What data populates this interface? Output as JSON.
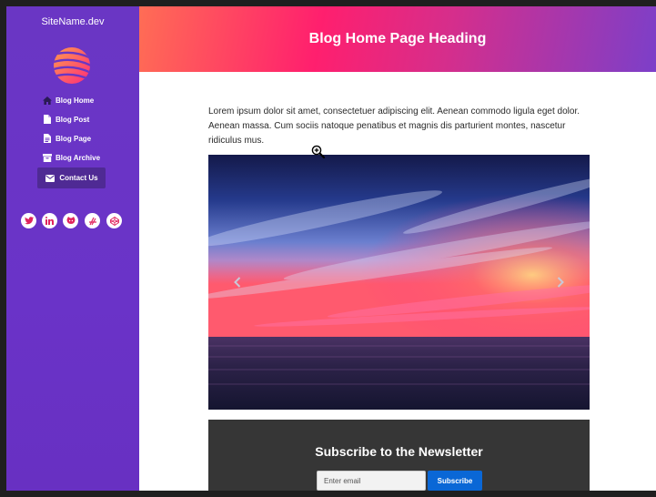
{
  "sidebar": {
    "site_name": "SiteName.dev",
    "items": [
      {
        "label": "Blog Home",
        "icon": "home-icon"
      },
      {
        "label": "Blog Post",
        "icon": "file-icon"
      },
      {
        "label": "Blog Page",
        "icon": "file-text-icon"
      },
      {
        "label": "Blog Archive",
        "icon": "archive-icon"
      },
      {
        "label": "Contact Us",
        "icon": "envelope-icon"
      }
    ],
    "social": [
      "twitter-icon",
      "linkedin-icon",
      "github-icon",
      "jsfiddle-icon",
      "codepen-icon"
    ]
  },
  "header": {
    "title": "Blog Home Page Heading"
  },
  "main": {
    "intro": "Lorem ipsum dolor sit amet, consectetuer adipiscing elit. Aenean commodo ligula eget dolor. Aenean massa. Cum sociis natoque penatibus et magnis dis parturient montes, nascetur ridiculus mus.",
    "carousel": {
      "image": "sunset over the sea",
      "prev_icon": "chevron-left-icon",
      "next_icon": "chevron-right-icon"
    }
  },
  "newsletter": {
    "title": "Subscribe to the Newsletter",
    "email_placeholder": "Enter email",
    "button_label": "Subscribe"
  },
  "colors": {
    "sidebar": "#6a36c4",
    "contact_active": "#4f2a94",
    "header_start": "#ff6d55",
    "header_mid": "#ff1f6e",
    "header_end": "#7c3fc9",
    "newsletter_bg": "#363636",
    "subscribe_button": "#0a67d6",
    "social_icon": "#e0245e"
  }
}
